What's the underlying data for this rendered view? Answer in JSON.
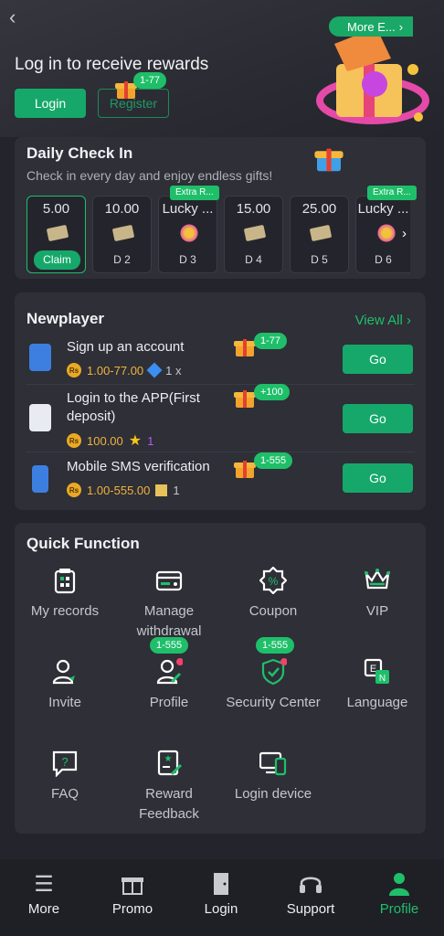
{
  "header": {
    "back_icon": "chevron-left-icon",
    "title": "Log in to receive rewards",
    "login_label": "Login",
    "register_label": "Register",
    "register_badge": "1-77"
  },
  "checkin": {
    "title": "Daily Check In",
    "subtitle": "Check in every day and enjoy endless gifts!",
    "more_events": "More E...",
    "days": [
      {
        "amount": "5.00",
        "label": "Claim",
        "tag": ""
      },
      {
        "amount": "10.00",
        "label": "D 2",
        "tag": ""
      },
      {
        "amount": "Lucky ...",
        "label": "D 3",
        "tag": "Extra R..."
      },
      {
        "amount": "15.00",
        "label": "D 4",
        "tag": ""
      },
      {
        "amount": "25.00",
        "label": "D 5",
        "tag": ""
      },
      {
        "amount": "Lucky ...",
        "label": "D 6",
        "tag": "Extra R..."
      }
    ]
  },
  "newplayer": {
    "title": "Newplayer",
    "view_all": "View All",
    "tasks": [
      {
        "title": "Sign up an account",
        "badge": "1-77",
        "reward": "1.00-77.00",
        "extra": "1 x",
        "go": "Go"
      },
      {
        "title": "Login to the APP(First deposit)",
        "badge": "+100",
        "reward": "100.00",
        "extra": "1",
        "go": "Go"
      },
      {
        "title": "Mobile SMS verification",
        "badge": "1-555",
        "reward": "1.00-555.00",
        "extra": "1",
        "go": "Go"
      }
    ],
    "currency_symbol": "Rs"
  },
  "quick": {
    "title": "Quick Function",
    "items": [
      {
        "label": "My records",
        "icon": "records-icon"
      },
      {
        "label": "Manage withdrawal",
        "icon": "withdrawal-icon"
      },
      {
        "label": "Coupon",
        "icon": "coupon-icon"
      },
      {
        "label": "VIP",
        "icon": "crown-icon"
      },
      {
        "label": "Invite",
        "icon": "invite-icon"
      },
      {
        "label": "Profile",
        "icon": "profile-icon",
        "badge": "1-555"
      },
      {
        "label": "Security Center",
        "icon": "shield-icon",
        "badge": "1-555"
      },
      {
        "label": "Language",
        "icon": "language-icon"
      },
      {
        "label": "FAQ",
        "icon": "faq-icon"
      },
      {
        "label": "Reward Feedback",
        "icon": "feedback-icon"
      },
      {
        "label": "Login device",
        "icon": "device-icon"
      }
    ]
  },
  "nav": {
    "items": [
      {
        "label": "More",
        "icon": "menu-icon"
      },
      {
        "label": "Promo",
        "icon": "gift-icon"
      },
      {
        "label": "Login",
        "icon": "door-icon"
      },
      {
        "label": "Support",
        "icon": "headset-icon"
      },
      {
        "label": "Profile",
        "icon": "user-icon"
      }
    ],
    "active": "Profile"
  },
  "colors": {
    "accent": "#1fbf6a",
    "button": "#16a86a",
    "gold": "#f0b23d",
    "background": "#24252c",
    "card": "#2e2f37"
  }
}
